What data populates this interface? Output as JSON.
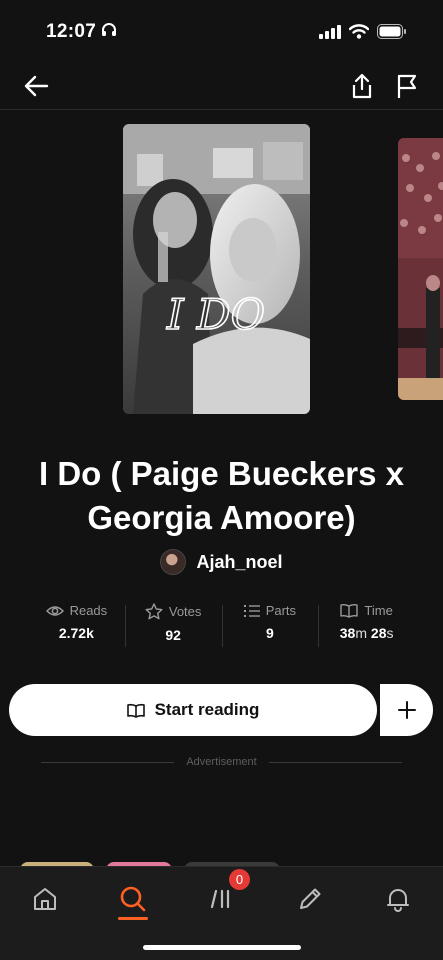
{
  "status_bar": {
    "time": "12:07"
  },
  "navigation": {
    "back_icon": "arrow-left-icon",
    "share_icon": "share-icon",
    "report_icon": "flag-icon"
  },
  "cover": {
    "overlay_text": "I DO"
  },
  "story": {
    "title": "I Do ( Paige Bueckers x Georgia Amoore)",
    "author": "Ajah_noel"
  },
  "stats": [
    {
      "label": "Reads",
      "value": "2.72k",
      "icon": "eye-icon"
    },
    {
      "label": "Votes",
      "value": "92",
      "icon": "star-icon"
    },
    {
      "label": "Parts",
      "value": "9",
      "icon": "list-icon"
    },
    {
      "label": "Time",
      "value_main_1": "38",
      "unit_1": "m",
      "value_main_2": "28",
      "unit_2": "s",
      "icon": "book-icon"
    }
  ],
  "actions": {
    "start_reading": "Start reading",
    "add_label": "+"
  },
  "ad": {
    "label": "Advertisement"
  },
  "tabs": [
    {
      "name": "home",
      "icon": "home-icon"
    },
    {
      "name": "search",
      "icon": "search-icon",
      "active": true
    },
    {
      "name": "library",
      "icon": "library-icon",
      "badge": "0"
    },
    {
      "name": "write",
      "icon": "pencil-icon"
    },
    {
      "name": "notifications",
      "icon": "bell-icon"
    }
  ],
  "colors": {
    "background": "#121212",
    "accent": "#ff6122",
    "badge": "#e53935"
  }
}
